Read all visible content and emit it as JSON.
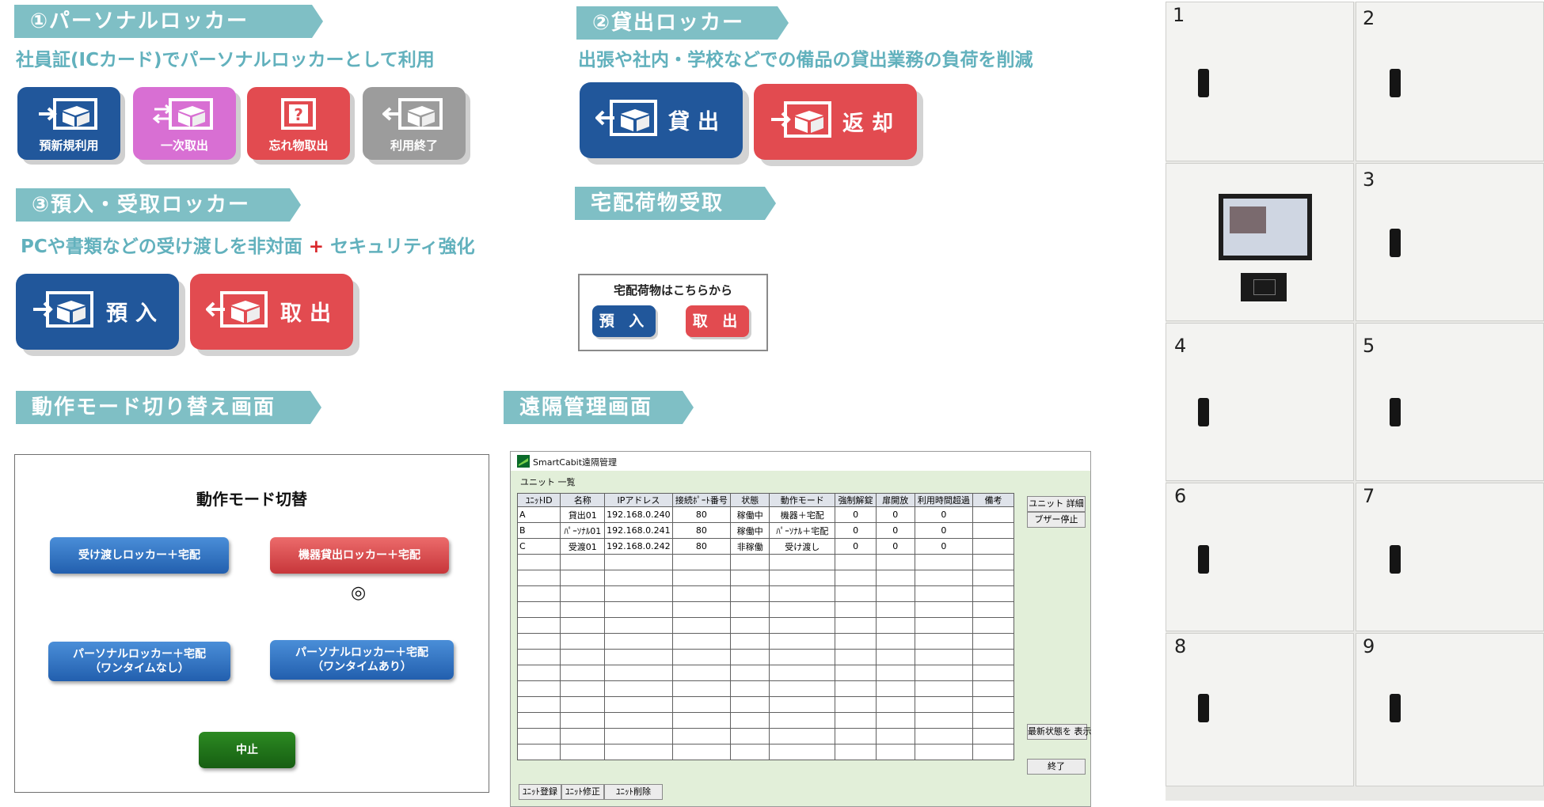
{
  "s1": {
    "title": "①パーソナルロッカー",
    "subtitle": "社員証(ICカード)でパーソナルロッカーとして利用",
    "buttons": [
      "預新規利用",
      "一次取出",
      "忘れ物取出",
      "利用終了"
    ]
  },
  "s2": {
    "title": "②貸出ロッカー",
    "subtitle": "出張や社内・学校などでの備品の貸出業務の負荷を削減",
    "buttons": [
      "貸出",
      "返却"
    ]
  },
  "s3": {
    "title": "③預入・受取ロッカー",
    "subtitle_a": "PCや書類などの受け渡しを非対面",
    "plus": "+",
    "subtitle_b": "セキュリティ強化",
    "buttons": [
      "預入",
      "取出"
    ]
  },
  "delivery": {
    "title": "宅配荷物受取",
    "box_title": "宅配荷物はこちらから",
    "buttons": [
      "預 入",
      "取 出"
    ]
  },
  "mode": {
    "section_title": "動作モード切り替え画面",
    "heading": "動作モード切替",
    "btn1": "受け渡しロッカー＋宅配",
    "btn2": "機器貸出ロッカー＋宅配",
    "selected_mark": "◎",
    "btn3_line1": "パーソナルロッカー＋宅配",
    "btn3_line2": "（ワンタイムなし）",
    "btn4_line1": "パーソナルロッカー＋宅配",
    "btn4_line2": "（ワンタイムあり）",
    "cancel": "中止"
  },
  "remote": {
    "section_title": "遠隔管理画面",
    "window_title": "SmartCabit遠隔管理",
    "list_label": "ユニット 一覧",
    "columns": [
      "ﾕﾆｯﾄID",
      "名称",
      "IPアドレス",
      "接続ﾎﾟｰﾄ番号",
      "状態",
      "動作モード",
      "強制解錠",
      "扉開放",
      "利用時間超過",
      "備考"
    ],
    "rows": [
      [
        "A",
        "貸出01",
        "192.168.0.240",
        "80",
        "稼働中",
        "機器＋宅配",
        "0",
        "0",
        "0",
        ""
      ],
      [
        "B",
        "ﾊﾟｰｿﾅﾙ01",
        "192.168.0.241",
        "80",
        "稼働中",
        "ﾊﾟｰｿﾅﾙ＋宅配",
        "0",
        "0",
        "0",
        ""
      ],
      [
        "C",
        "受渡01",
        "192.168.0.242",
        "80",
        "非稼働",
        "受け渡し",
        "0",
        "0",
        "0",
        ""
      ]
    ],
    "side_buttons": [
      "ユニット 詳細",
      "ブザー停止",
      "最新状態を 表示",
      "終了"
    ],
    "bottom_buttons": [
      "ﾕﾆｯﾄ登録",
      "ﾕﾆｯﾄ修正",
      "ﾕﾆｯﾄ削除"
    ]
  },
  "locker_numbers": [
    "1",
    "2",
    "3",
    "4",
    "5",
    "6",
    "7",
    "8",
    "9"
  ]
}
